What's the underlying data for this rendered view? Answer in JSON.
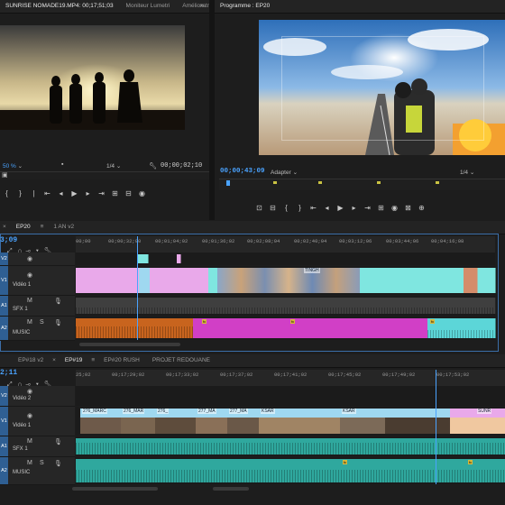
{
  "source_monitor": {
    "tabs": [
      "SUNRISE NOMADE19.MP4: 00;17;51;03",
      "Moniteur Lumetri",
      "Amélioratn"
    ],
    "zoom": "50 %",
    "resolution": "1/4",
    "timecode": "00;00;02;10"
  },
  "program_monitor": {
    "tab": "Programme : EP20",
    "timecode": "00;00;43;09",
    "fit": "Adapter",
    "resolution": "1/4"
  },
  "timeline_top": {
    "tabs": [
      "EP20",
      "1 AN v2"
    ],
    "timecode": "3;09",
    "ruler": [
      "00;00",
      "00;00;32;00",
      "00;01;04;02",
      "00;01;36;02",
      "00;02;08;04",
      "00;02;40;04",
      "00;03;12;06",
      "00;03;44;06",
      "00;04;16;08"
    ],
    "tracks": [
      {
        "id": "V2",
        "name": ""
      },
      {
        "id": "V1",
        "name": "Vidéo 1"
      },
      {
        "id": "A1",
        "name": "SFX 1"
      },
      {
        "id": "A2",
        "name": "MUSIC"
      }
    ],
    "clip_labels": [
      "TINGH"
    ]
  },
  "timeline_bottom": {
    "tabs": [
      "EP#18 v2",
      "EP#19",
      "EP#20 RUSH",
      "PROJET REDOUANE"
    ],
    "timecode": "2;11",
    "ruler": [
      "25;02",
      "00;17;29;02",
      "00;17;33;02",
      "00;17;37;02",
      "00;17;41;02",
      "00;17;45;02",
      "00;17;49;02",
      "00;17;53;02"
    ],
    "tracks": [
      {
        "id": "V2",
        "name": "Vidéo 2"
      },
      {
        "id": "V1",
        "name": "Vidéo 1"
      },
      {
        "id": "A1",
        "name": "SFX 1"
      },
      {
        "id": "A2",
        "name": "MUSIC"
      }
    ],
    "clip_labels": [
      "276_MARC",
      "276_MAR",
      "276_",
      "277_MA",
      "277_MA",
      "KSAR",
      "KSAR",
      "SUNR"
    ]
  },
  "icons": [
    "settings-icon",
    "camera-icon",
    "play-icon",
    "step-back-icon",
    "step-forward-icon",
    "loop-icon",
    "wrench-icon",
    "magnet-icon",
    "eye-icon",
    "mic-icon",
    "lock-icon"
  ],
  "colors": {
    "accent": "#4aa3ff",
    "video_clip": "#7fe6e0",
    "video_clip_pink": "#e9a9ea",
    "audio_orange": "#c8641e",
    "audio_magenta": "#d13fc6",
    "audio_teal": "#2fa89e"
  }
}
